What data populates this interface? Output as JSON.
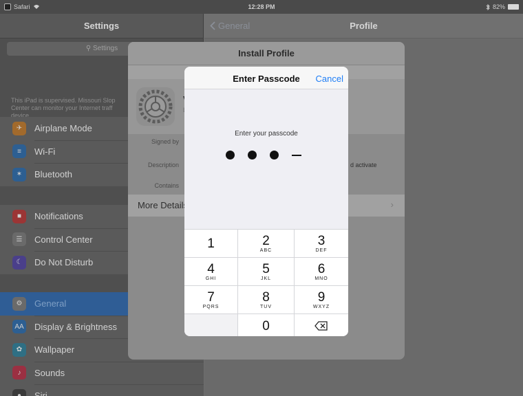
{
  "status_bar": {
    "carrier": "Safari",
    "time": "12:28 PM",
    "battery": "82%"
  },
  "master": {
    "title": "Settings",
    "search_placeholder": "Settings",
    "supervision_note": "This iPad is supervised. Missouri Slop Center can monitor your Internet traff device.",
    "groups": [
      [
        {
          "label": "Airplane Mode",
          "icon": "airplane-icon",
          "color": "#a26a2c"
        },
        {
          "label": "Wi-Fi",
          "icon": "wifi-icon",
          "color": "#2d5f92"
        },
        {
          "label": "Bluetooth",
          "icon": "bluetooth-icon",
          "color": "#2d5f92"
        }
      ],
      [
        {
          "label": "Notifications",
          "icon": "notifications-icon",
          "color": "#9b3535"
        },
        {
          "label": "Control Center",
          "icon": "control-center-icon",
          "color": "#6a6a6a"
        },
        {
          "label": "Do Not Disturb",
          "icon": "moon-icon",
          "color": "#4a3f8a"
        }
      ],
      [
        {
          "label": "General",
          "icon": "gear-icon",
          "color": "#6a6a6a",
          "selected": true
        },
        {
          "label": "Display & Brightness",
          "icon": "display-icon",
          "color": "#2d5f92"
        },
        {
          "label": "Wallpaper",
          "icon": "wallpaper-icon",
          "color": "#2f6f84"
        },
        {
          "label": "Sounds",
          "icon": "sounds-icon",
          "color": "#9b3042"
        },
        {
          "label": "Siri",
          "icon": "siri-icon",
          "color": "#3a3a3a"
        }
      ]
    ]
  },
  "detail": {
    "back_label": "General",
    "title": "Profile"
  },
  "install_sheet": {
    "title": "Install Profile",
    "name_fragment": "V",
    "sub_fragment": "L",
    "signed_by_label": "Signed by",
    "description_label": "Description",
    "description_fragment": "d activate",
    "contains_label": "Contains",
    "more_details": "More Details"
  },
  "passcode": {
    "title": "Enter Passcode",
    "cancel": "Cancel",
    "prompt": "Enter your passcode",
    "filled": 3,
    "keys": [
      {
        "n": "1",
        "s": ""
      },
      {
        "n": "2",
        "s": "ABC"
      },
      {
        "n": "3",
        "s": "DEF"
      },
      {
        "n": "4",
        "s": "GHI"
      },
      {
        "n": "5",
        "s": "JKL"
      },
      {
        "n": "6",
        "s": "MNO"
      },
      {
        "n": "7",
        "s": "PQRS"
      },
      {
        "n": "8",
        "s": "TUV"
      },
      {
        "n": "9",
        "s": "WXYZ"
      },
      {
        "n": "",
        "s": ""
      },
      {
        "n": "0",
        "s": ""
      },
      {
        "n": "delete",
        "s": ""
      }
    ]
  }
}
